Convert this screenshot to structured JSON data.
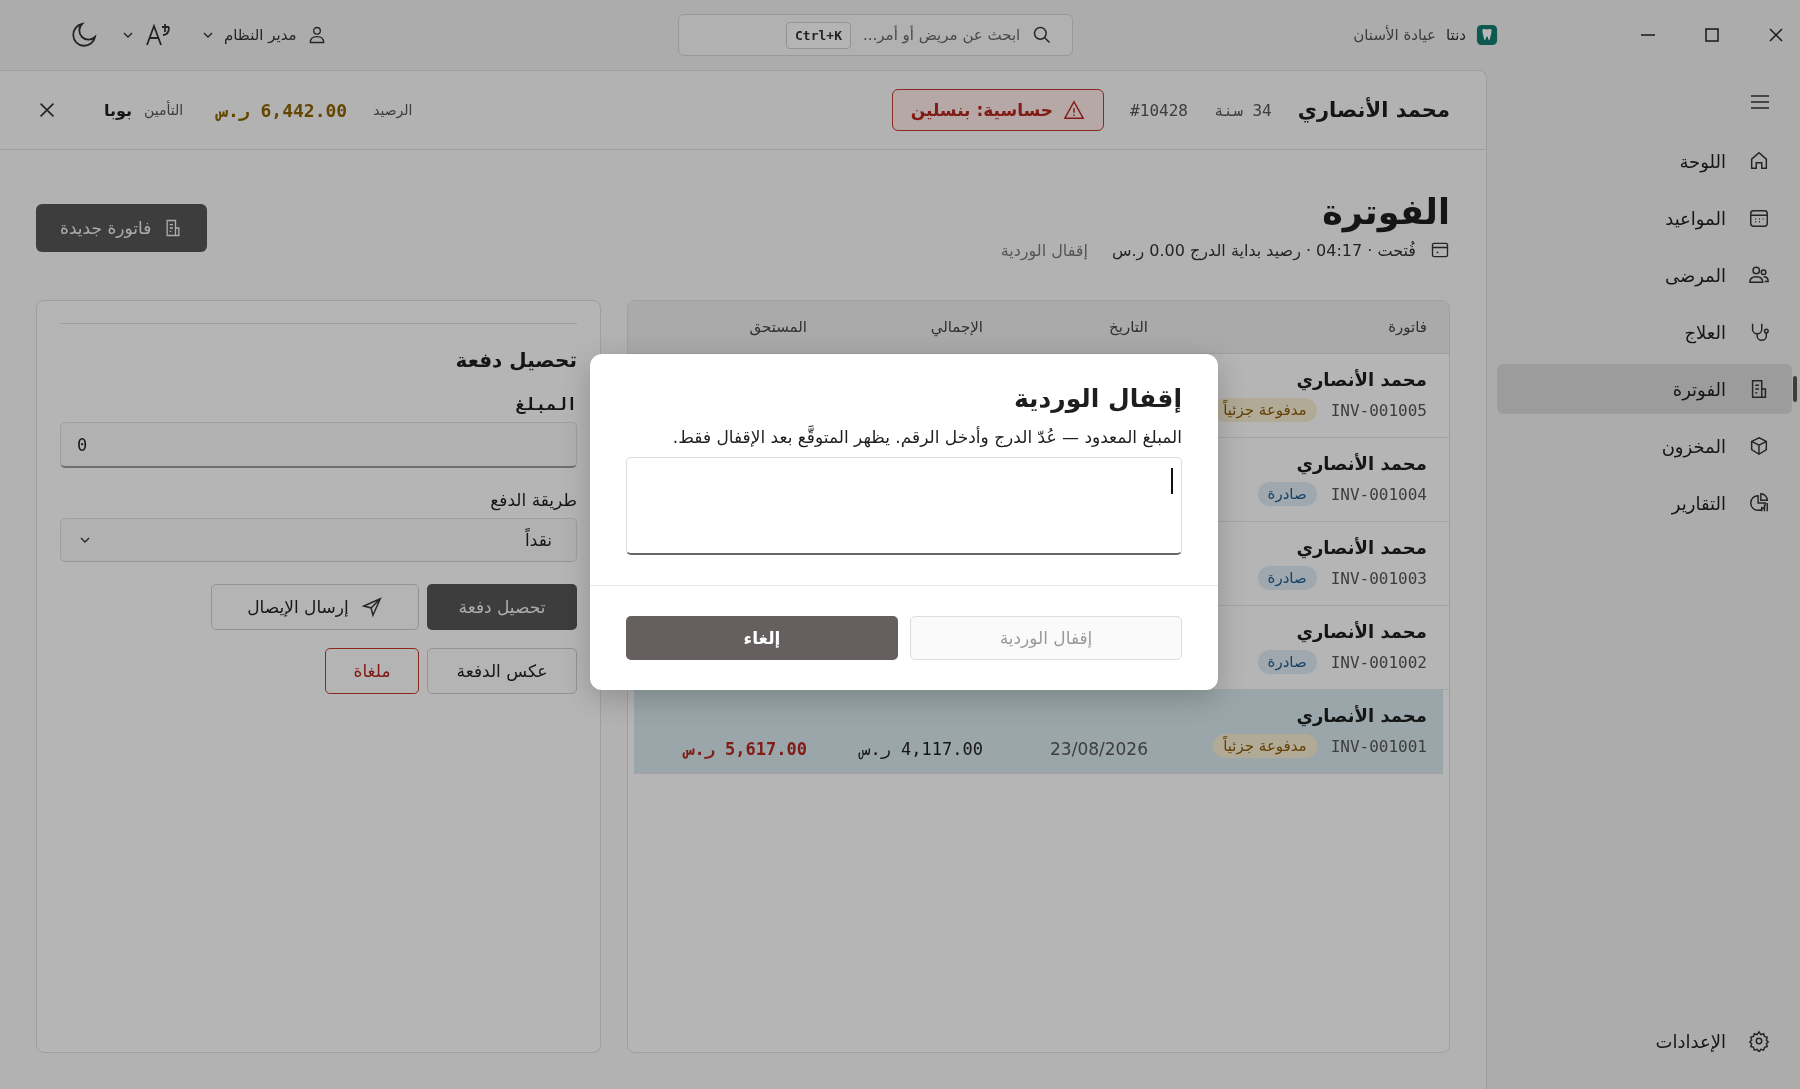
{
  "titlebar": {
    "app_name": "دنتا",
    "app_subtitle": "عيادة الأسنان",
    "search": {
      "placeholder": "ابحث عن مريض أو أمر...",
      "shortcut": "Ctrl+K"
    },
    "user": "مدير النظام"
  },
  "sidebar": {
    "items": [
      {
        "label": "اللوحة",
        "selected": false
      },
      {
        "label": "المواعيد",
        "selected": false
      },
      {
        "label": "المرضى",
        "selected": false
      },
      {
        "label": "العلاج",
        "selected": false
      },
      {
        "label": "الفوترة",
        "selected": true
      },
      {
        "label": "المخزون",
        "selected": false
      },
      {
        "label": "التقارير",
        "selected": false
      }
    ],
    "settings": "الإعدادات"
  },
  "patient": {
    "name": "محمد الأنصاري",
    "age": "34 سنة",
    "number": "#10428",
    "allergy": "حساسية: بنسلين",
    "balance_label": "الرصيد",
    "balance": "6,442.00 ر.س",
    "insurance_label": "التأمين",
    "insurance": "بوبا"
  },
  "page": {
    "title": "الفوترة",
    "shift_info": "فُتحت · 04:17 · رصيد بداية الدرج 0.00 ر.س",
    "close_shift": "إقفال الوردية",
    "new_invoice": "فاتورة جديدة"
  },
  "payment": {
    "title": "تحصيل دفعة",
    "amount_label": "المبلغ",
    "amount_value": "0",
    "method_label": "طريقة الدفع",
    "method_value": "نقداً",
    "buttons": [
      {
        "label": "تحصيل دفعة",
        "kind": "primary"
      },
      {
        "label": "إرسال الإيصال",
        "kind": "send"
      },
      {
        "label": "عكس الدفعة",
        "kind": "outline"
      },
      {
        "label": "ملغاة",
        "kind": "danger"
      }
    ]
  },
  "invoices": {
    "columns": [
      "فاتورة",
      "التاريخ",
      "الإجمالي",
      "المستحق"
    ],
    "rows": [
      {
        "patient": "محمد الأنصاري",
        "number": "INV-001005",
        "status": "مدفوعة جزئياً",
        "kind": "partial",
        "selected": false
      },
      {
        "patient": "محمد الأنصاري",
        "number": "INV-001004",
        "status": "صادرة",
        "kind": "issued",
        "selected": false
      },
      {
        "patient": "محمد الأنصاري",
        "number": "INV-001003",
        "status": "صادرة",
        "kind": "issued",
        "selected": false
      },
      {
        "patient": "محمد الأنصاري",
        "number": "INV-001002",
        "status": "صادرة",
        "kind": "issued",
        "selected": false
      },
      {
        "patient": "محمد الأنصاري",
        "number": "INV-001001",
        "status": "مدفوعة جزئياً",
        "kind": "partial",
        "date": "23/08/2026",
        "total": "4,117.00 ر.س",
        "due": "5,617.00 ر.س",
        "selected": true
      }
    ]
  },
  "dialog": {
    "title": "إقفال الوردية",
    "description": "المبلغ المعدود — عُدّ الدرج وأدخل الرقم. يظهر المتوقَّع بعد الإقفال فقط.",
    "buttons": [
      {
        "label": "إقفال الوردية",
        "kind": "secondary",
        "disabled": true
      },
      {
        "label": "إلغاء",
        "kind": "primary",
        "disabled": false
      }
    ]
  }
}
